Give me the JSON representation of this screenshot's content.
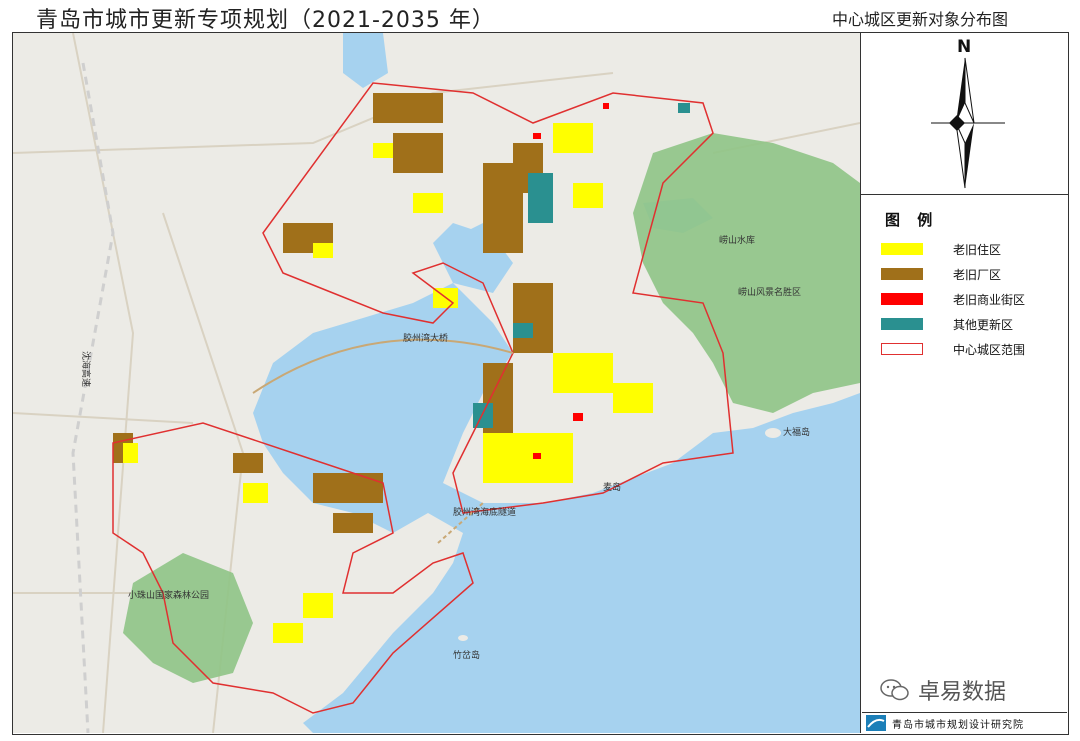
{
  "header": {
    "title": "青岛市城市更新专项规划（2021-2035 年）",
    "subtitle": "中心城区更新对象分布图"
  },
  "compass": {
    "north": "N"
  },
  "legend": {
    "title": "图 例",
    "items": [
      {
        "label": "老旧住区",
        "color": "#ffff00"
      },
      {
        "label": "老旧厂区",
        "color": "#a0701a"
      },
      {
        "label": "老旧商业街区",
        "color": "#ff0000"
      },
      {
        "label": "其他更新区",
        "color": "#2a9090"
      },
      {
        "label": "中心城区范围",
        "color": "#e03030"
      }
    ]
  },
  "map_labels": {
    "bridge": "胶州湾大桥",
    "tunnel": "胶州湾海底隧道",
    "laoshan": "崂山风景名胜区",
    "xiaozhushan": "小珠山国家森林公园",
    "dafu_island": "大福岛",
    "mai_island": "麦岛",
    "zhucha_island": "竹岔岛",
    "west_road": "沈海高速",
    "reservoir": "崂山水库"
  },
  "colors": {
    "sea": "#a6d2ef",
    "land": "#ecebe6",
    "mountain": "#8fc486"
  },
  "watermark": {
    "text": "卓易数据"
  },
  "footer": {
    "institute": "青岛市城市规划设计研究院"
  }
}
